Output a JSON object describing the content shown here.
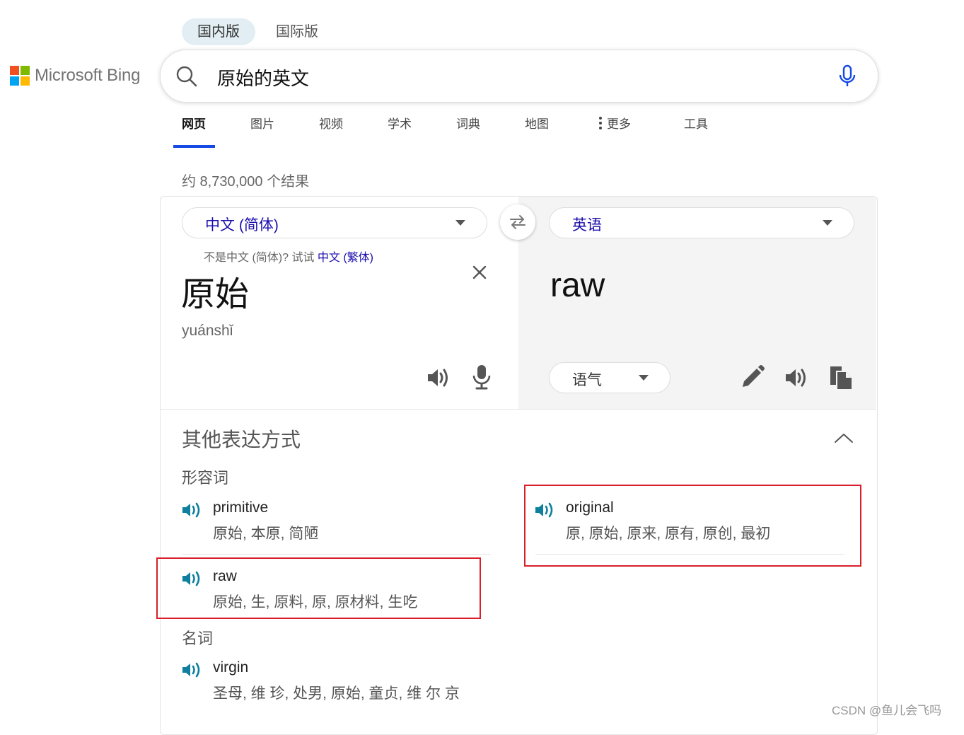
{
  "market_tabs": [
    "国内版",
    "国际版"
  ],
  "logo": {
    "text": "Microsoft Bing"
  },
  "search": {
    "query": "原始的英文"
  },
  "nav": [
    "网页",
    "图片",
    "视频",
    "学术",
    "词典",
    "地图",
    "更多",
    "工具"
  ],
  "results_count": "约 8,730,000 个结果",
  "translator": {
    "source_lang": "中文 (简体)",
    "target_lang": "英语",
    "hint_prefix": "不是中文 (简体)? 试试",
    "hint_link": "中文 (繁体)",
    "source_text": "原始",
    "pinyin": "yuánshǐ",
    "target_text": "raw",
    "tone_label": "语气"
  },
  "alternatives": {
    "title": "其他表达方式",
    "groups": [
      {
        "pos": "形容词",
        "entries": [
          {
            "word": "primitive",
            "def": "原始, 本原, 简陋"
          },
          {
            "word": "original",
            "def": "原, 原始, 原来, 原有, 原创, 最初"
          },
          {
            "word": "raw",
            "def": "原始, 生, 原料, 原, 原材料, 生吃"
          }
        ]
      },
      {
        "pos": "名词",
        "entries": [
          {
            "word": "virgin",
            "def": "圣母, 维 珍, 处男, 原始, 童贞, 维 尔 京"
          }
        ]
      }
    ]
  },
  "watermark": "CSDN @鱼儿会飞吗",
  "colors": {
    "accent": "#174ae4",
    "link": "#1a0dab",
    "speaker": "#0e7f9e",
    "highlight": "#d9202a"
  }
}
